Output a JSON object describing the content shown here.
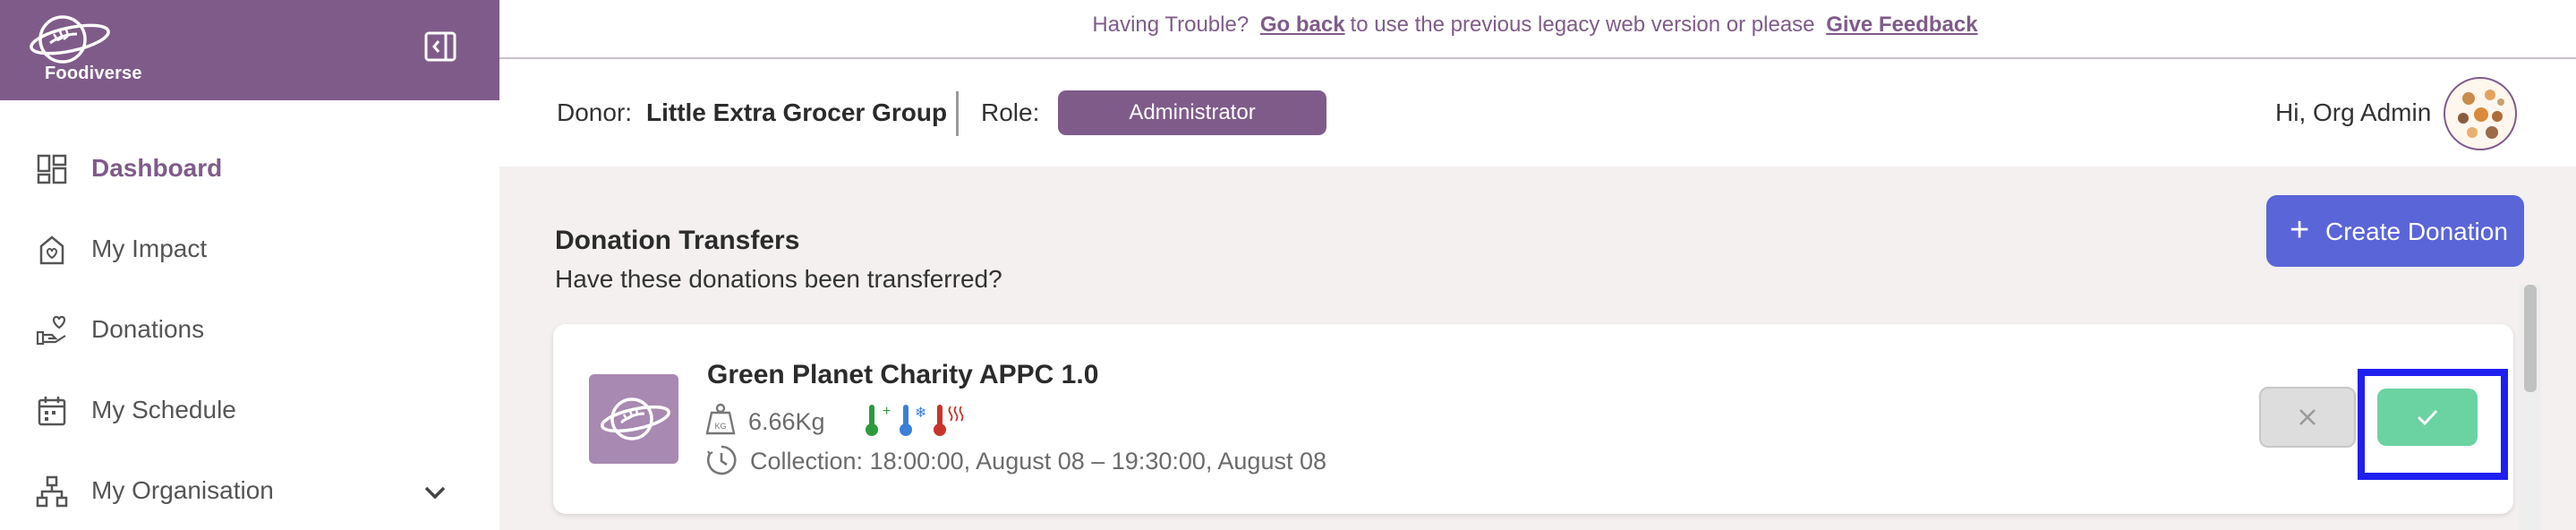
{
  "app": {
    "brand_name": "Foodiverse",
    "accent_color": "#7f5b8a",
    "highlight_color": "#1f1ff0"
  },
  "banner": {
    "prefix": "Having Trouble?",
    "link_back": "Go back",
    "middle": "to use the previous legacy web version or please",
    "link_feedback": "Give Feedback"
  },
  "sidebar": {
    "collapse_icon": "sidebar-collapse-icon",
    "items": [
      {
        "label": "Dashboard",
        "icon": "dashboard-icon",
        "active": true
      },
      {
        "label": "My Impact",
        "icon": "impact-icon",
        "active": false
      },
      {
        "label": "Donations",
        "icon": "donations-icon",
        "active": false
      },
      {
        "label": "My Schedule",
        "icon": "calendar-icon",
        "active": false
      },
      {
        "label": "My Organisation",
        "icon": "organisation-icon",
        "active": false,
        "expandable": true
      }
    ]
  },
  "header": {
    "donor_label": "Donor:",
    "donor_name": "Little Extra Grocer Group",
    "role_label": "Role:",
    "role_value": "Administrator",
    "greeting": "Hi, Org Admin"
  },
  "main": {
    "section_title": "Donation Transfers",
    "section_subtitle": "Have these donations been transferred?",
    "create_button": "Create Donation",
    "transfers": [
      {
        "charity": "Green Planet Charity APPC 1.0",
        "weight": "6.66Kg",
        "collection": "Collection: 18:00:00, August 08 – 19:30:00, August 08",
        "storage_icons": [
          "ambient-temp-icon",
          "frozen-temp-icon",
          "hot-temp-icon"
        ],
        "status_colors": {
          "accept": "#6bd2a2",
          "reject": "#dddddd"
        }
      }
    ]
  }
}
